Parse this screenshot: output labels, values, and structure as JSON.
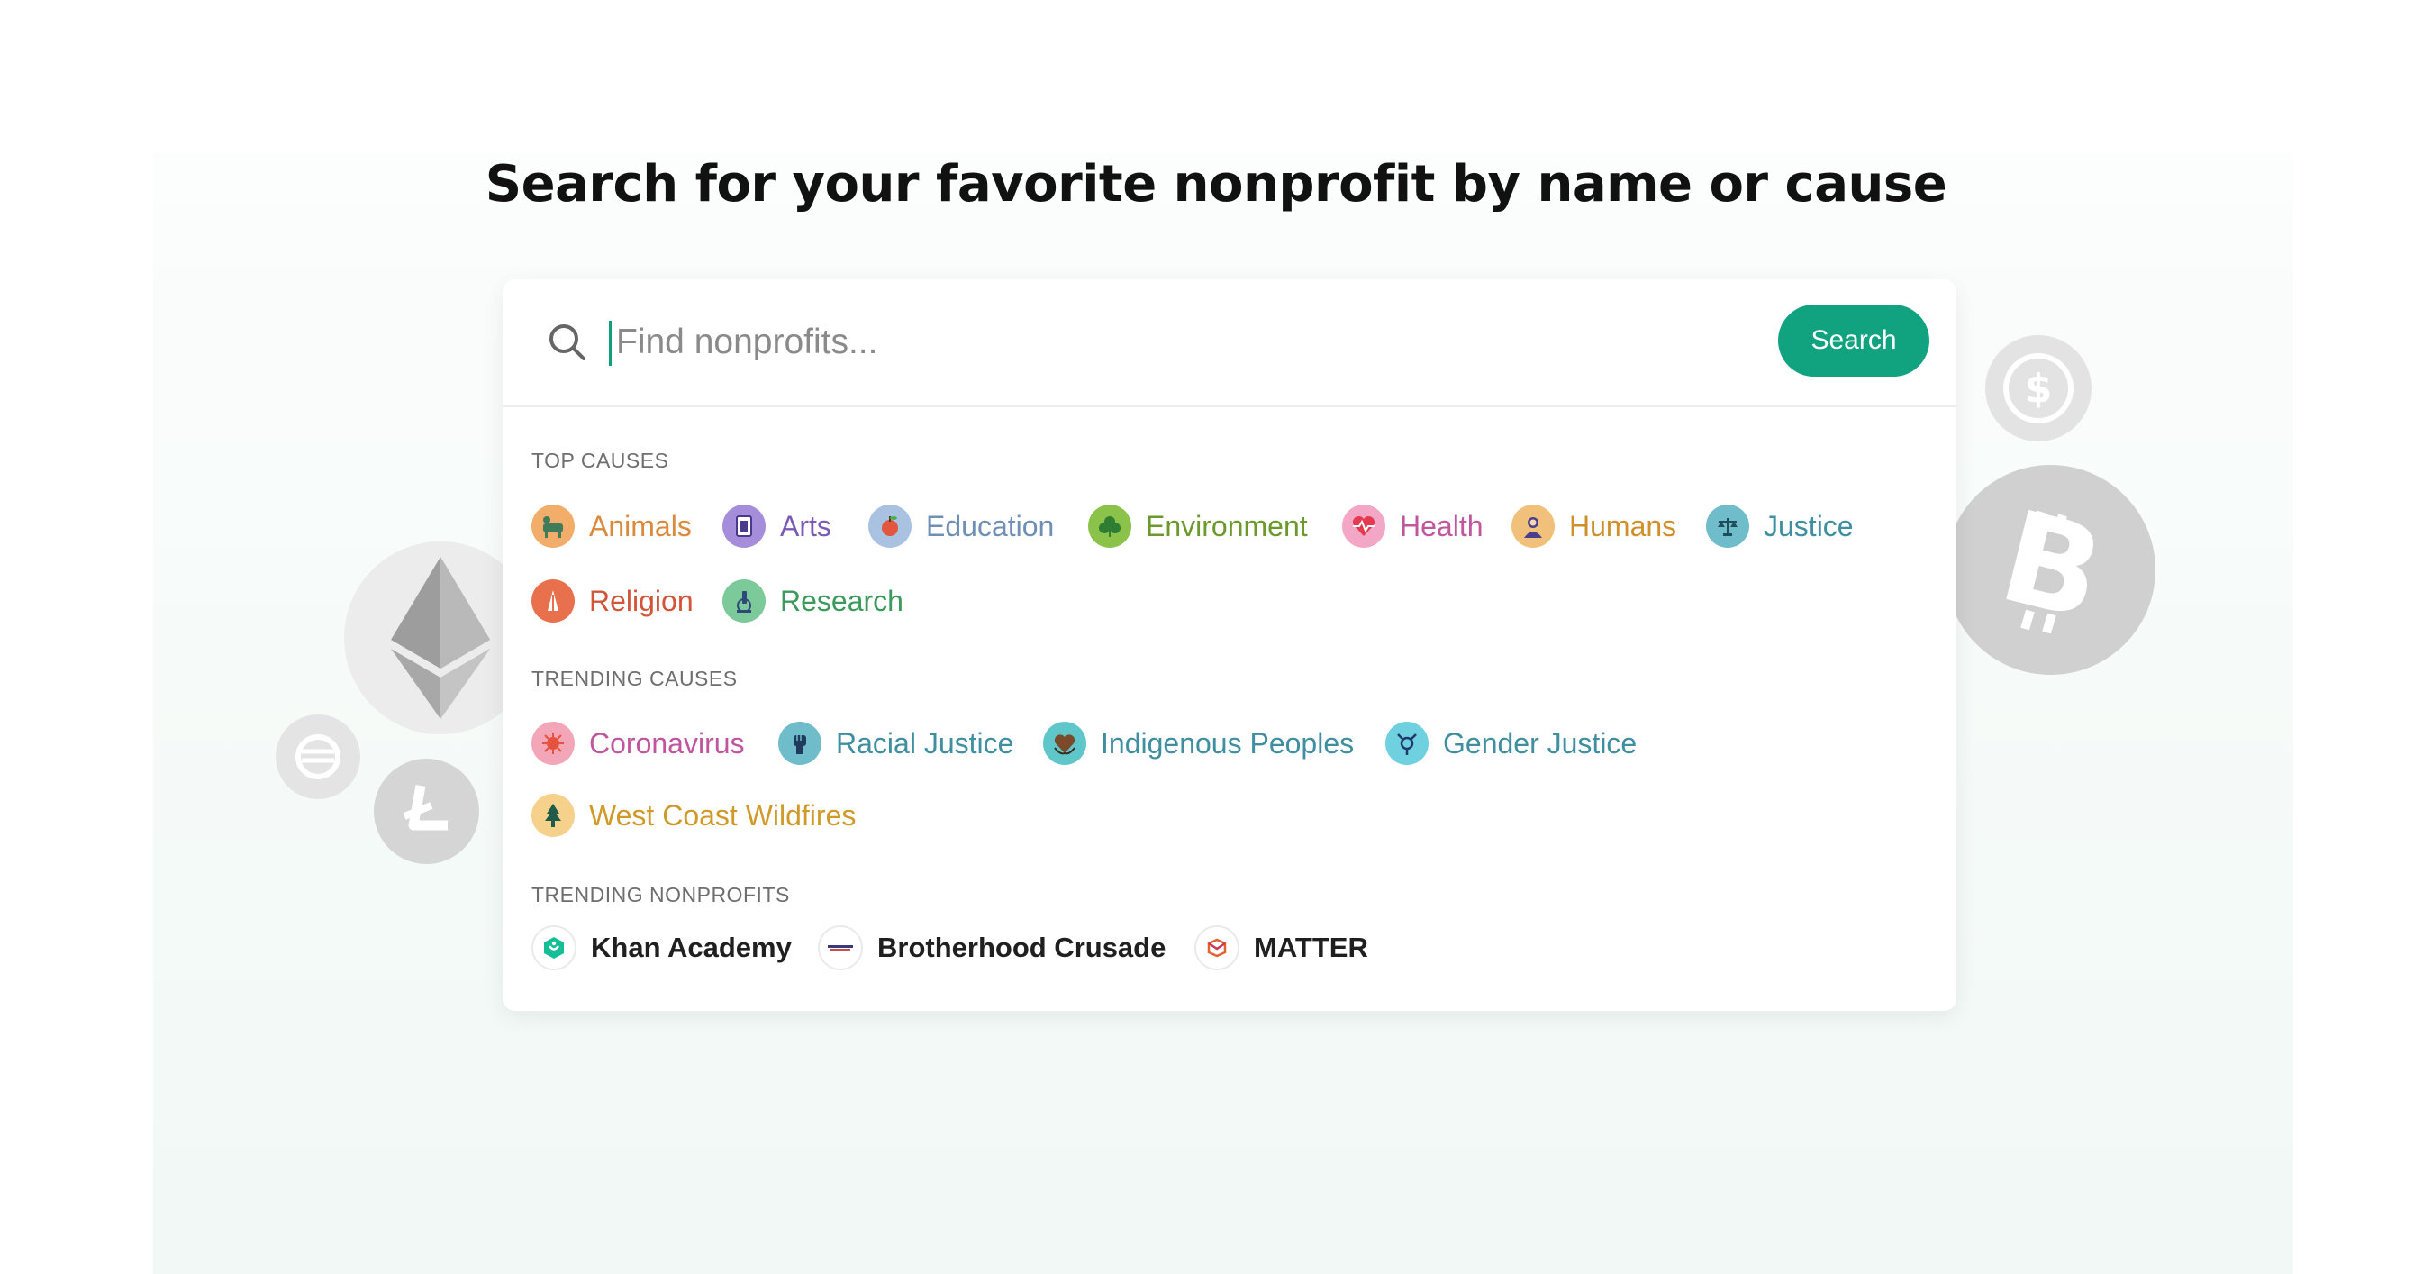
{
  "page": {
    "heading": "Search for your favorite nonprofit by name or cause"
  },
  "search": {
    "placeholder": "Find nonprofits...",
    "value": "",
    "button_label": "Search"
  },
  "top_causes": {
    "label": "TOP CAUSES",
    "items": [
      {
        "label": "Animals",
        "color": "#d98a3d",
        "icon_bg": "#f2ad6b",
        "icon": "animals-icon"
      },
      {
        "label": "Arts",
        "color": "#7a5bb5",
        "icon_bg": "#a58ddc",
        "icon": "arts-icon"
      },
      {
        "label": "Education",
        "color": "#6f8fb5",
        "icon_bg": "#a9c2e2",
        "icon": "education-icon"
      },
      {
        "label": "Environment",
        "color": "#6b9a2c",
        "icon_bg": "#8bc34a",
        "icon": "environment-icon"
      },
      {
        "label": "Health",
        "color": "#c0569d",
        "icon_bg": "#f3a6c6",
        "icon": "health-icon"
      },
      {
        "label": "Humans",
        "color": "#cf8f2a",
        "icon_bg": "#f1c07a",
        "icon": "humans-icon"
      },
      {
        "label": "Justice",
        "color": "#3f8fa0",
        "icon_bg": "#6fbccb",
        "icon": "justice-icon"
      },
      {
        "label": "Religion",
        "color": "#d2553a",
        "icon_bg": "#e8704d",
        "icon": "religion-icon"
      },
      {
        "label": "Research",
        "color": "#3b9a5c",
        "icon_bg": "#7cc99a",
        "icon": "research-icon"
      }
    ]
  },
  "trending_causes": {
    "label": "TRENDING CAUSES",
    "items": [
      {
        "label": "Coronavirus",
        "color": "#c0569d",
        "icon_bg": "#f3a6b8",
        "icon": "coronavirus-icon"
      },
      {
        "label": "Racial Justice",
        "color": "#3f8fa0",
        "icon_bg": "#6fbccb",
        "icon": "fist-icon"
      },
      {
        "label": "Indigenous Peoples",
        "color": "#3f8fa0",
        "icon_bg": "#5fc6c9",
        "icon": "heart-hands-icon"
      },
      {
        "label": "Gender Justice",
        "color": "#3f8fa0",
        "icon_bg": "#6fd0e0",
        "icon": "gender-icon"
      },
      {
        "label": "West Coast Wildfires",
        "color": "#cf9a2a",
        "icon_bg": "#f6d18b",
        "icon": "tree-icon"
      }
    ]
  },
  "trending_nonprofits": {
    "label": "TRENDING NONPROFITS",
    "items": [
      {
        "label": "Khan Academy",
        "icon": "khan-academy-logo"
      },
      {
        "label": "Brotherhood Crusade",
        "icon": "brotherhood-crusade-logo"
      },
      {
        "label": "MATTER",
        "icon": "matter-logo"
      }
    ]
  },
  "colors": {
    "accent": "#11a37f",
    "heading": "#111111"
  }
}
